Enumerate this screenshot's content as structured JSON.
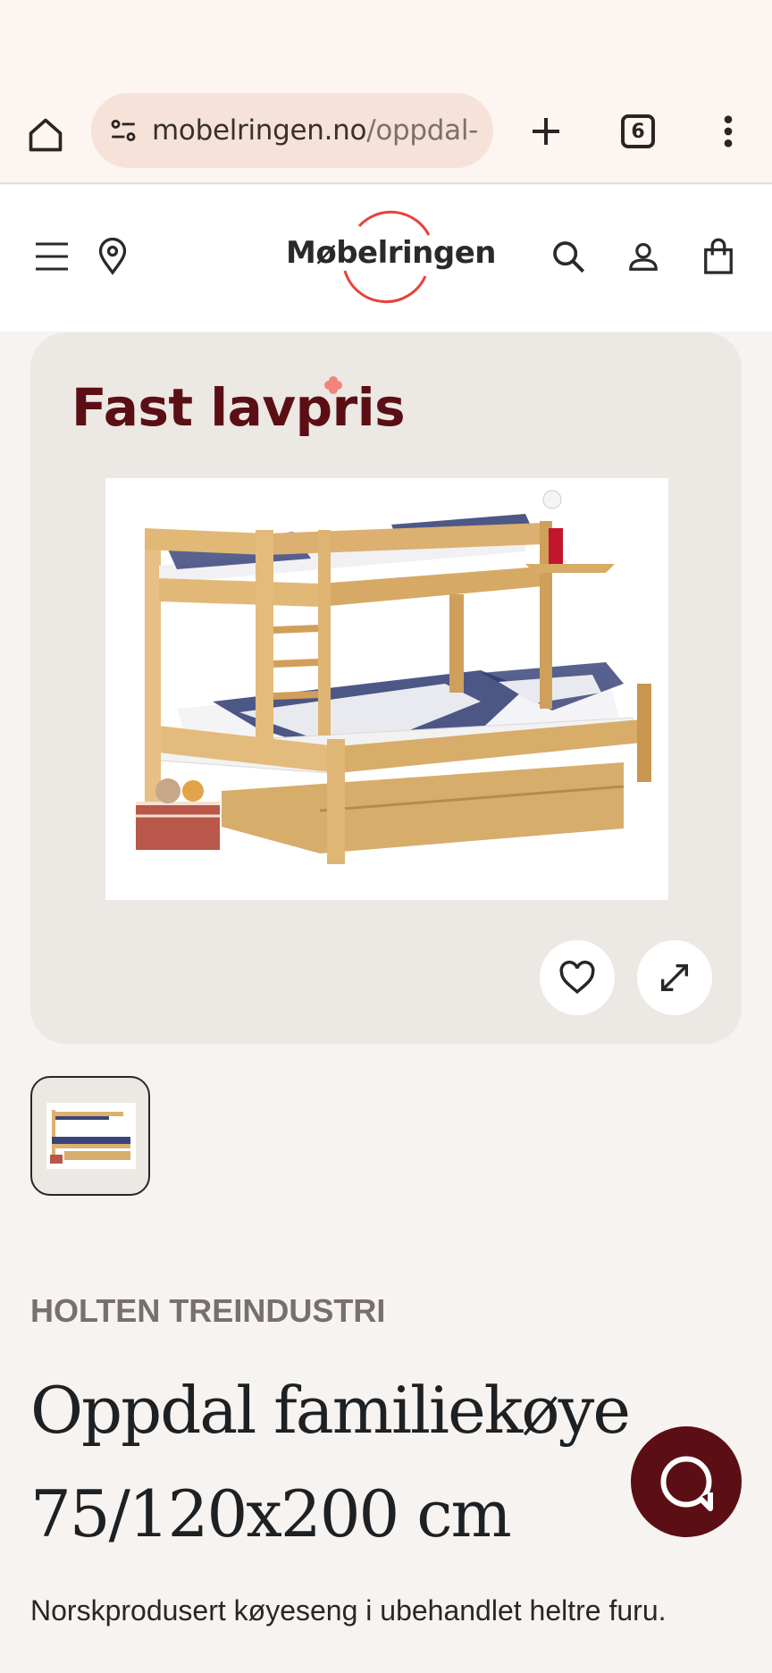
{
  "browser": {
    "url_host": "mobelringen.no",
    "url_path": "/oppdal-",
    "tab_count": "6"
  },
  "header": {
    "logo_text": "Møbelringen"
  },
  "product": {
    "badge": "Fast lavpris",
    "brand": "HOLTEN TREINDUSTRI",
    "title": "Oppdal familiekøye 75/120x200 cm",
    "description": "Norskprodusert køyeseng i ubehandlet heltre furu."
  },
  "colors": {
    "accent": "#5b0f14",
    "logo_ring": "#e8413c",
    "background": "#f7f3f0"
  },
  "icons": [
    "home-icon",
    "site-info-icon",
    "plus-icon",
    "tabs-icon",
    "more-vert-icon",
    "hamburger-menu-icon",
    "location-pin-icon",
    "search-icon",
    "account-icon",
    "cart-icon",
    "heart-icon",
    "expand-icon",
    "chat-icon"
  ]
}
